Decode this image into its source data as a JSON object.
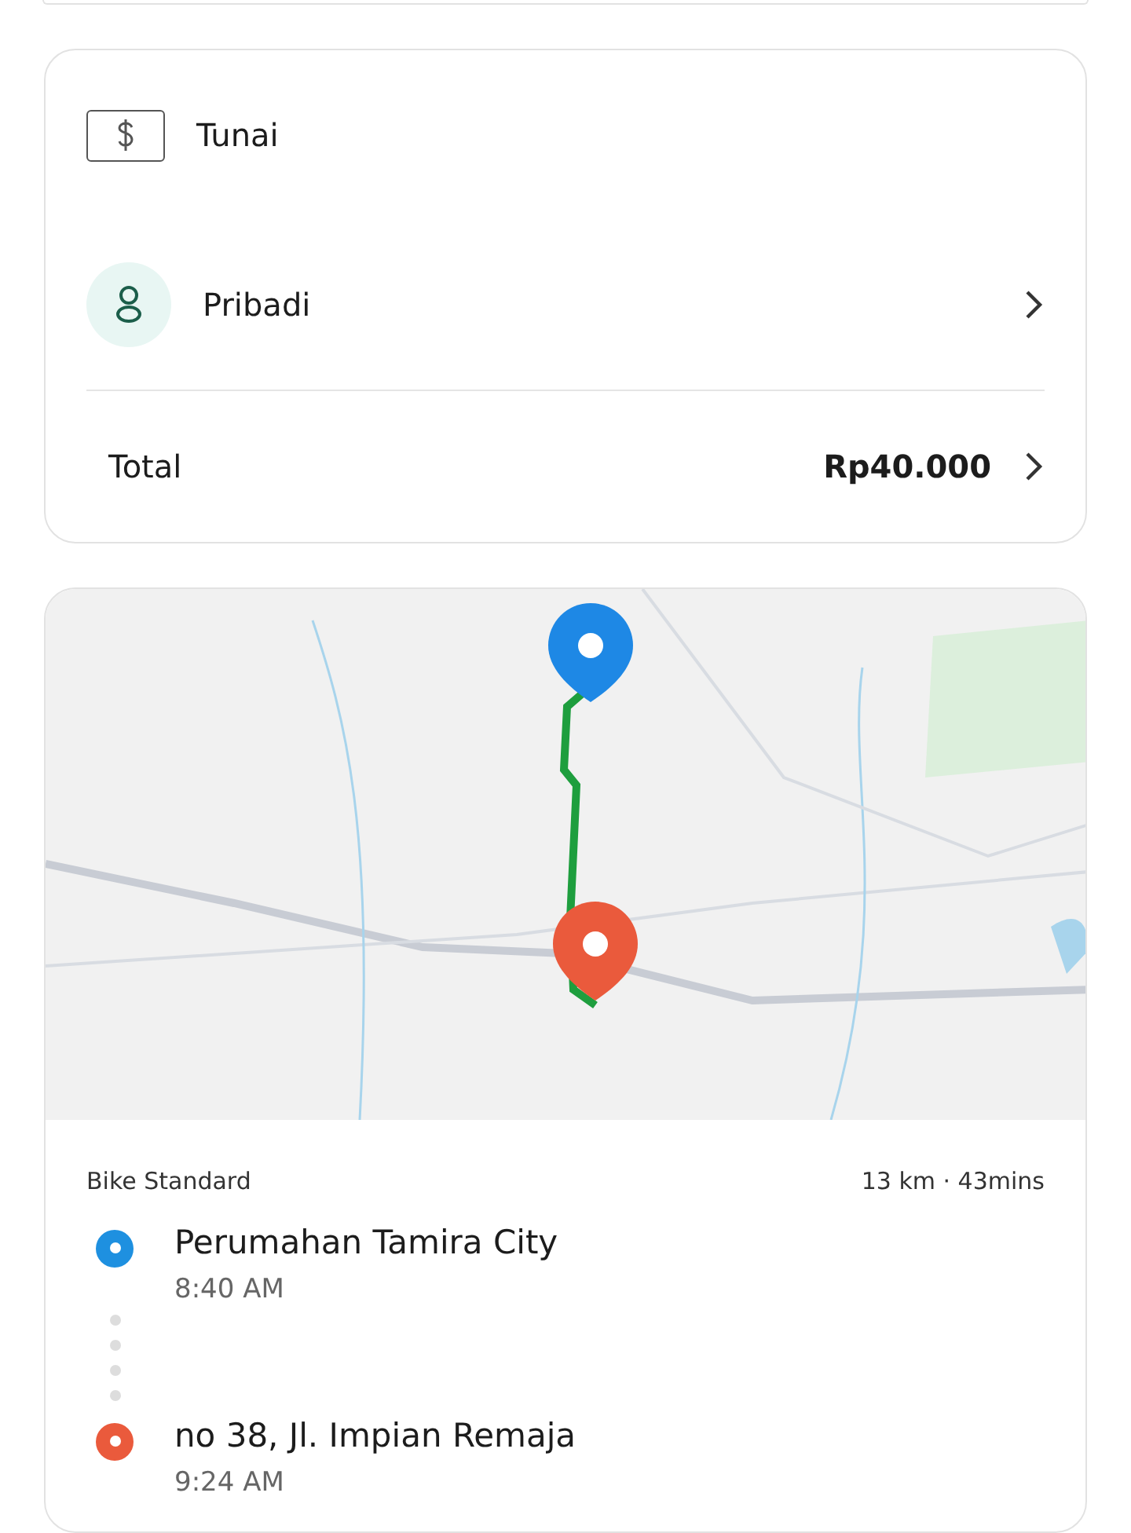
{
  "payment": {
    "method": "Tunai",
    "profile": "Pribadi",
    "total_label": "Total",
    "total_value": "Rp40.000"
  },
  "trip": {
    "service": "Bike Standard",
    "summary": "13 km · 43mins",
    "stops": [
      {
        "name": "Perumahan Tamira City",
        "time": "8:40 AM",
        "color": "#1e90e0"
      },
      {
        "name": "no 38, Jl. Impian Remaja",
        "time": "9:24 AM",
        "color": "#ea5a3c"
      }
    ]
  }
}
